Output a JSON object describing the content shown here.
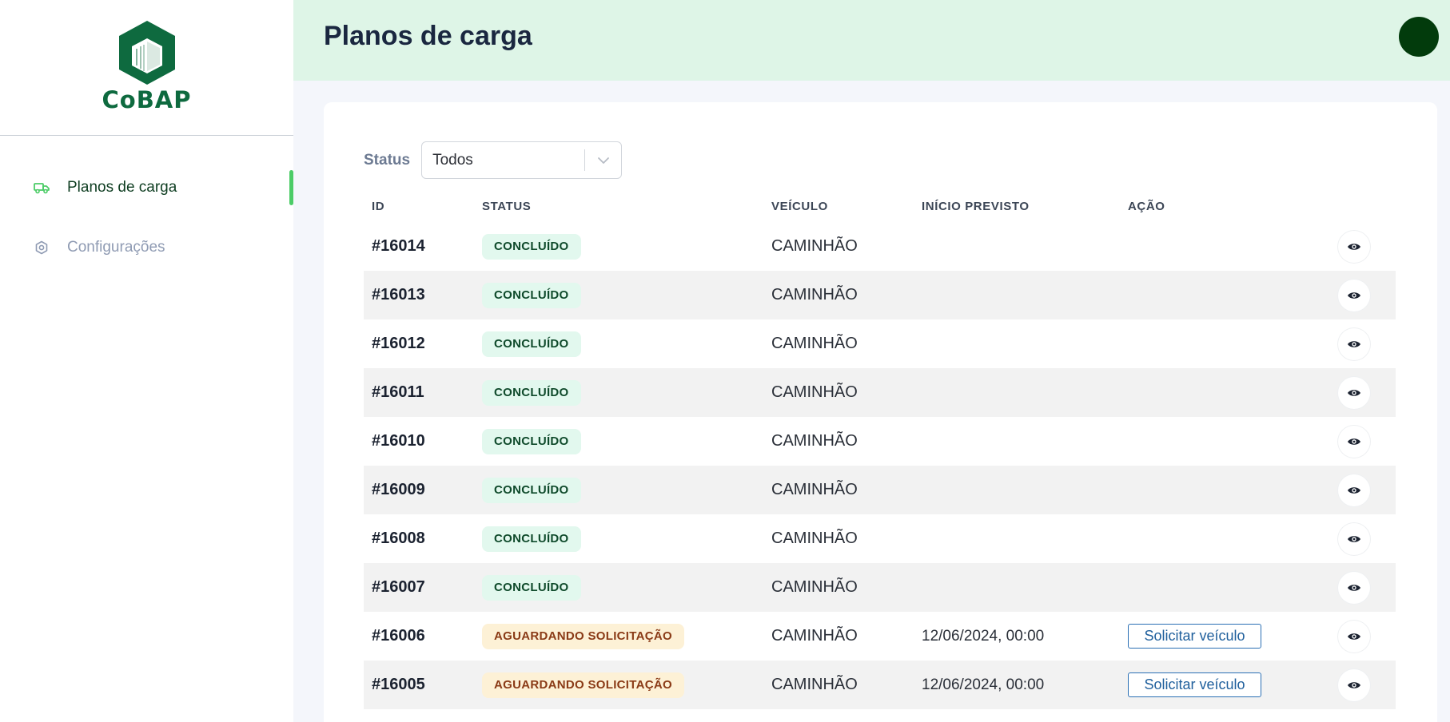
{
  "brand": {
    "name": "CoBAP",
    "color": "#0e6a3f"
  },
  "sidebar": {
    "items": [
      {
        "label": "Planos de carga",
        "icon": "truck-icon",
        "active": true
      },
      {
        "label": "Configurações",
        "icon": "settings-icon",
        "active": false
      }
    ]
  },
  "header": {
    "title": "Planos de carga"
  },
  "filter": {
    "label": "Status",
    "value": "Todos"
  },
  "table": {
    "columns": [
      "ID",
      "STATUS",
      "VEÍCULO",
      "INÍCIO PREVISTO",
      "AÇÃO"
    ],
    "rows": [
      {
        "id": "#16014",
        "status": "CONCLUÍDO",
        "status_type": "done",
        "vehicle": "CAMINHÃO",
        "start": "",
        "action": ""
      },
      {
        "id": "#16013",
        "status": "CONCLUÍDO",
        "status_type": "done",
        "vehicle": "CAMINHÃO",
        "start": "",
        "action": ""
      },
      {
        "id": "#16012",
        "status": "CONCLUÍDO",
        "status_type": "done",
        "vehicle": "CAMINHÃO",
        "start": "",
        "action": ""
      },
      {
        "id": "#16011",
        "status": "CONCLUÍDO",
        "status_type": "done",
        "vehicle": "CAMINHÃO",
        "start": "",
        "action": ""
      },
      {
        "id": "#16010",
        "status": "CONCLUÍDO",
        "status_type": "done",
        "vehicle": "CAMINHÃO",
        "start": "",
        "action": ""
      },
      {
        "id": "#16009",
        "status": "CONCLUÍDO",
        "status_type": "done",
        "vehicle": "CAMINHÃO",
        "start": "",
        "action": ""
      },
      {
        "id": "#16008",
        "status": "CONCLUÍDO",
        "status_type": "done",
        "vehicle": "CAMINHÃO",
        "start": "",
        "action": ""
      },
      {
        "id": "#16007",
        "status": "CONCLUÍDO",
        "status_type": "done",
        "vehicle": "CAMINHÃO",
        "start": "",
        "action": ""
      },
      {
        "id": "#16006",
        "status": "AGUARDANDO SOLICITAÇÃO",
        "status_type": "wait",
        "vehicle": "CAMINHÃO",
        "start": "12/06/2024, 00:00",
        "action": "Solicitar veículo"
      },
      {
        "id": "#16005",
        "status": "AGUARDANDO SOLICITAÇÃO",
        "status_type": "wait",
        "vehicle": "CAMINHÃO",
        "start": "12/06/2024, 00:00",
        "action": "Solicitar veículo"
      }
    ]
  },
  "colors": {
    "header_bg": "#def5e7",
    "active_accent": "#4ccc67",
    "avatar": "#023b0c",
    "badge_done_bg": "#e2f8ee",
    "badge_wait_bg": "#fdf1d6",
    "button_border": "#2a6fb4"
  },
  "icons": {
    "row_view": "eye-icon",
    "select_arrow": "chevron-down-icon",
    "user": "avatar"
  }
}
